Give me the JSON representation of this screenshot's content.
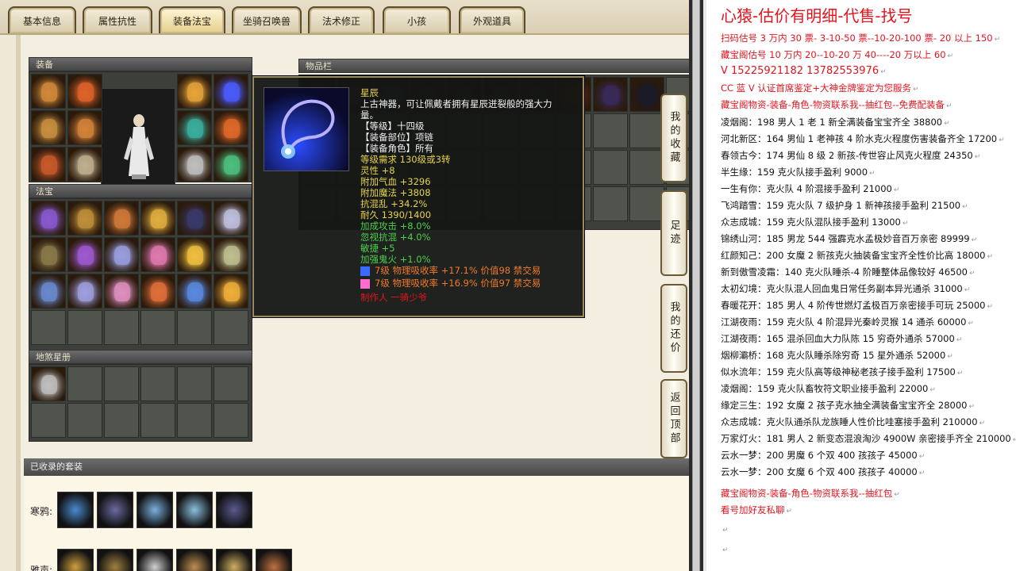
{
  "tabs": [
    {
      "label": "基本信息",
      "active": false
    },
    {
      "label": "属性抗性",
      "active": false
    },
    {
      "label": "装备法宝",
      "active": true
    },
    {
      "label": "坐骑召唤兽",
      "active": false
    },
    {
      "label": "法术修正",
      "active": false
    },
    {
      "label": "小孩",
      "active": false
    },
    {
      "label": "外观道具",
      "active": false
    }
  ],
  "panels": {
    "equipment": "装备",
    "fabao": "法宝",
    "dishaxingce": "地煞星册",
    "inventory": "物品栏",
    "collected_suits": "已收录的套装"
  },
  "tooltip": {
    "name": "星辰",
    "desc1": "上古神器，可让佩戴者拥有星辰迸裂般的强大力",
    "desc2": "量。",
    "level": "【等级】十四级",
    "slot": "【装备部位】项链",
    "role": "【装备角色】所有",
    "req": "等级需求 130级或3转",
    "lingxing": "灵性 +8",
    "hp": "附加气血 +3296",
    "mp": "附加魔法 +3808",
    "kanghunluan": "抗混乱 +34.2%",
    "durability": "耐久 1390/1400",
    "attack": "加成攻击 +8.0%",
    "hushikanghun": "忽视抗混 +4.0%",
    "agility": "敏捷 +5",
    "guihuo": "加强鬼火 +1.0%",
    "gem1": "7级 物理吸收率 +17.1% 价值98 禁交易",
    "gem2": "7级 物理吸收率 +16.9% 价值97 禁交易",
    "maker": "制作人 一骑少爷"
  },
  "side_buttons": [
    "我的收藏",
    "足迹",
    "我的还价",
    "返回顶部"
  ],
  "suit_rows": [
    {
      "label": "寒鸦:"
    },
    {
      "label": "雅声:"
    }
  ],
  "right": {
    "title": "心猿-估价有明细-代售-找号",
    "lines": [
      {
        "text": "扫码估号 3 万内 30 票- 3-10-50 票--10-20-100 票- 20 以上 150",
        "red": true
      },
      {
        "text": "藏宝阁估号 10 万内 20--10-20 万 40----20 万以上 60",
        "red": true
      },
      {
        "text": "V 15225921182    13782553976",
        "red": true,
        "big": true
      },
      {
        "text": "CC 蓝 V 认证首席鉴定+大神金牌鉴定为您服务",
        "red": true
      },
      {
        "text": "藏宝阁物资-装备-角色-物资联系我--抽红包--免费配装备",
        "red": true
      },
      {
        "text": "凌烟阁：198 男人 1 老 1 新全满装备宝宝齐全 38800",
        "red": false
      },
      {
        "text": "河北新区：164 男仙 1 老神孩 4 阶水克火程度伤害装备齐全 17200",
        "red": false
      },
      {
        "text": "春领古今：174 男仙 8 级 2 新孩-传世容止风克火程度 24350",
        "red": false
      },
      {
        "text": "半生缘：159 克火队接手盈利 9000",
        "red": false
      },
      {
        "text": "一生有你：克火队 4 阶混接手盈利 21000",
        "red": false
      },
      {
        "text": "飞鸿踏雪：159 克火队 7 级护身 1 新神孩接手盈利 21500",
        "red": false
      },
      {
        "text": "众志成城：159 克火队混队接手盈利 13000",
        "red": false
      },
      {
        "text": "锦绣山河：185 男龙 544 强霹克水孟极妙音百万亲密 89999",
        "red": false
      },
      {
        "text": "红颜知己：200 女魔 2 新孩克火抽装备宝宝齐全性价比高 18000",
        "red": false
      },
      {
        "text": "新到傲雪凌霜：140 克火队睡杀-4 阶睡整体品像较好 46500",
        "red": false
      },
      {
        "text": "太初幻境：克火队混人回血鬼日常任务副本异光通杀 31000",
        "red": false
      },
      {
        "text": "春暖花开：185 男人 4 阶传世燃灯孟极百万亲密接手可玩 25000",
        "red": false
      },
      {
        "text": "江湖夜雨：159 克火队 4 阶混异光秦岭灵猴 14 通杀 60000",
        "red": false
      },
      {
        "text": "江湖夜雨：165 混杀回血大力队陈 15 穷奇外通杀 57000",
        "red": false
      },
      {
        "text": "烟柳灞桥：168 克火队睡杀除穷奇 15 星外通杀 52000",
        "red": false
      },
      {
        "text": "似水流年：159 克火队高等级神秘老孩子接手盈利 17500",
        "red": false
      },
      {
        "text": "凌烟阁：159 克火队畜牧符文职业接手盈利 22000",
        "red": false
      },
      {
        "text": "缘定三生：192 女魔 2 孩子克水抽全满装备宝宝齐全 28000",
        "red": false
      },
      {
        "text": "众志成城：克火队通杀队龙族睡人性价比哇塞接手盈利 210000",
        "red": false
      },
      {
        "text": "万家灯火：181 男人 2 新变态混浪淘沙 4900W 亲密接手齐全 210000",
        "red": false
      },
      {
        "text": "云水一梦：200 男魔 6 个双 400 孩孩子 45000",
        "red": false
      },
      {
        "text": "云水一梦：200 女魔 6 个双 400 孩孩子 40000",
        "red": false
      },
      {
        "text": "藏宝阁物资-装备-角色-物资联系我--抽红包",
        "red": true
      },
      {
        "text": "看号加好友私聊",
        "red": true
      },
      {
        "text": "",
        "red": false
      },
      {
        "text": "",
        "red": false
      }
    ]
  },
  "colors": {
    "red_text": "#e3141e",
    "tooltip_title": "#e6d24a",
    "tooltip_green": "#4ed14e",
    "tooltip_orange": "#f07a2a",
    "tooltip_white": "#f0f0f0"
  }
}
